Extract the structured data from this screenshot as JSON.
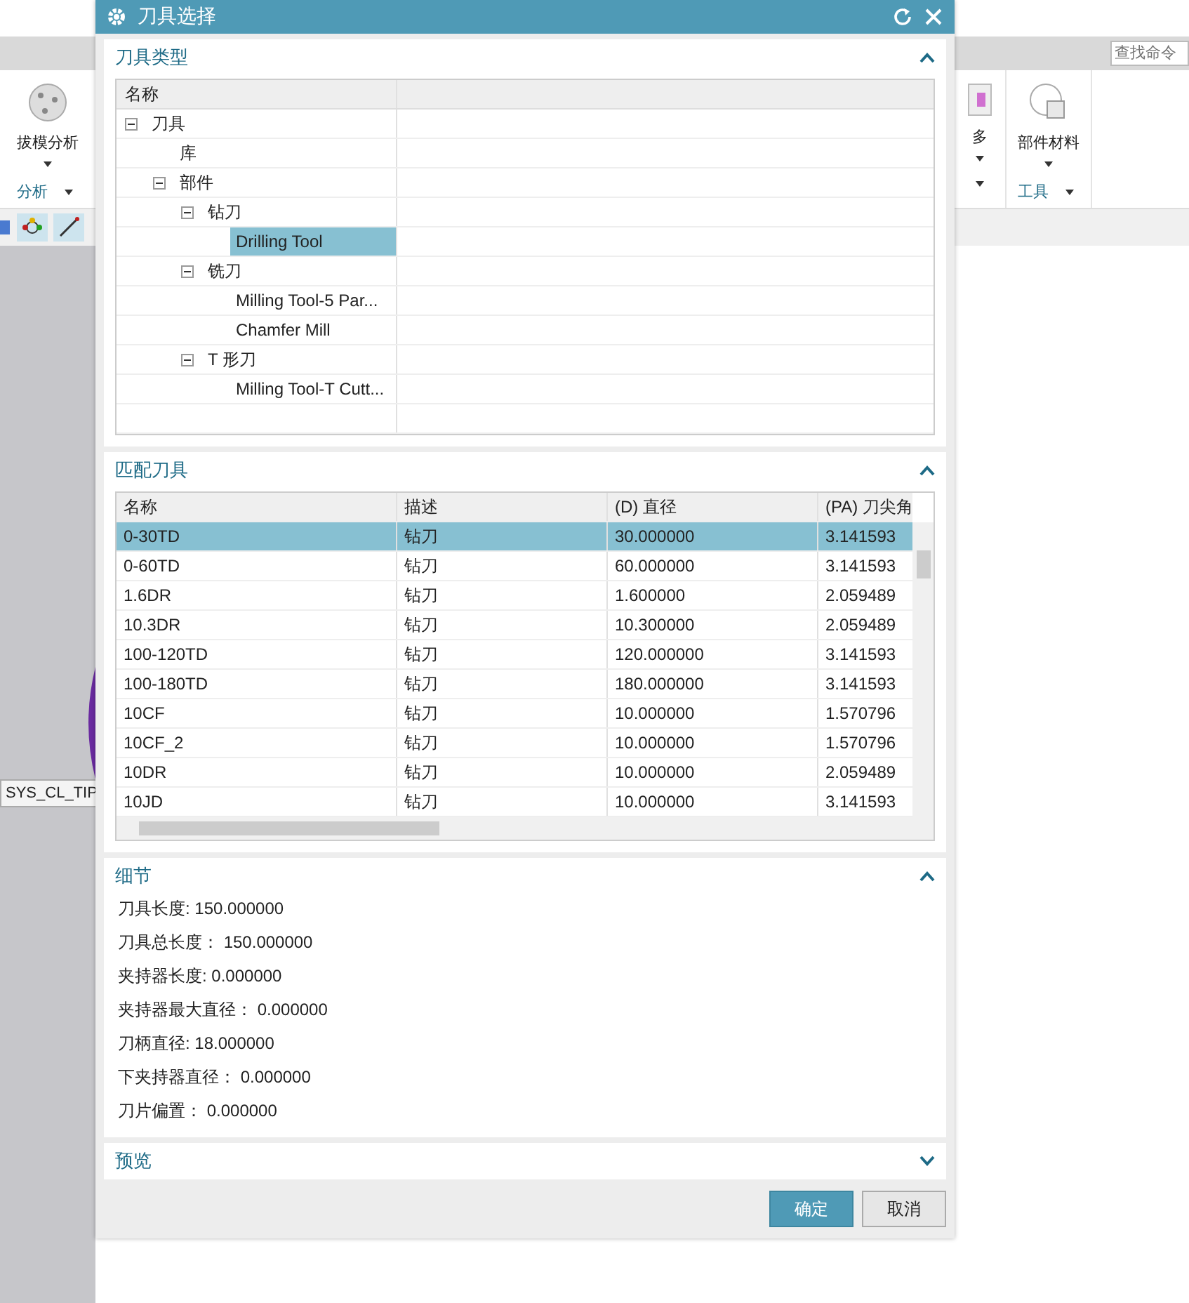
{
  "app": {
    "search": {
      "placeholder": "查找命令"
    },
    "ribbon_left": {
      "button": "拔模分析",
      "group": "分析"
    },
    "ribbon_right": {
      "more_button": "多",
      "button": "部件材料",
      "group": "工具"
    },
    "canvas_label": "SYS_CL_TIP"
  },
  "dialog": {
    "title": "刀具选择",
    "sections": [
      {
        "kind": "tree",
        "title": "刀具类型",
        "expanded": true,
        "columns": [
          "名称"
        ],
        "nodes": [
          {
            "label": "刀具",
            "expanded": true,
            "selected": false,
            "children": [
              {
                "label": "库",
                "selected": false
              },
              {
                "label": "部件",
                "expanded": true,
                "selected": false,
                "children": [
                  {
                    "label": "钻刀",
                    "expanded": true,
                    "selected": false,
                    "children": [
                      {
                        "label": "Drilling Tool",
                        "selected": true
                      }
                    ]
                  },
                  {
                    "label": "铣刀",
                    "expanded": true,
                    "selected": false,
                    "children": [
                      {
                        "label": "Milling Tool-5 Par...",
                        "selected": false
                      },
                      {
                        "label": "Chamfer Mill",
                        "selected": false
                      }
                    ]
                  },
                  {
                    "label": "T 形刀",
                    "expanded": true,
                    "selected": false,
                    "children": [
                      {
                        "label": "Milling Tool-T Cutt...",
                        "selected": false
                      }
                    ]
                  }
                ]
              }
            ]
          }
        ]
      },
      {
        "kind": "table",
        "title": "匹配刀具",
        "expanded": true,
        "columns": [
          "名称",
          "描述",
          "(D) 直径",
          "(PA) 刀尖角"
        ],
        "rows": [
          {
            "cells": [
              "0-30TD",
              "钻刀",
              "30.000000",
              "3.141593"
            ],
            "selected": true
          },
          {
            "cells": [
              "0-60TD",
              "钻刀",
              "60.000000",
              "3.141593"
            ],
            "selected": false
          },
          {
            "cells": [
              "1.6DR",
              "钻刀",
              "1.600000",
              "2.059489"
            ],
            "selected": false
          },
          {
            "cells": [
              "10.3DR",
              "钻刀",
              "10.300000",
              "2.059489"
            ],
            "selected": false
          },
          {
            "cells": [
              "100-120TD",
              "钻刀",
              "120.000000",
              "3.141593"
            ],
            "selected": false
          },
          {
            "cells": [
              "100-180TD",
              "钻刀",
              "180.000000",
              "3.141593"
            ],
            "selected": false
          },
          {
            "cells": [
              "10CF",
              "钻刀",
              "10.000000",
              "1.570796"
            ],
            "selected": false
          },
          {
            "cells": [
              "10CF_2",
              "钻刀",
              "10.000000",
              "1.570796"
            ],
            "selected": false
          },
          {
            "cells": [
              "10DR",
              "钻刀",
              "10.000000",
              "2.059489"
            ],
            "selected": false
          },
          {
            "cells": [
              "10JD",
              "钻刀",
              "10.000000",
              "3.141593"
            ],
            "selected": false
          }
        ]
      },
      {
        "kind": "details",
        "title": "细节",
        "expanded": true,
        "lines": [
          "刀具长度: 150.000000",
          "刀具总长度： 150.000000",
          "夹持器长度: 0.000000",
          "夹持器最大直径： 0.000000",
          "刀柄直径: 18.000000",
          "下夹持器直径： 0.000000",
          "刀片偏置： 0.000000"
        ]
      },
      {
        "kind": "preview",
        "title": "预览",
        "expanded": false
      }
    ],
    "buttons": [
      {
        "label": "确定",
        "kind": "primary"
      },
      {
        "label": "取消",
        "kind": "secondary"
      }
    ]
  }
}
